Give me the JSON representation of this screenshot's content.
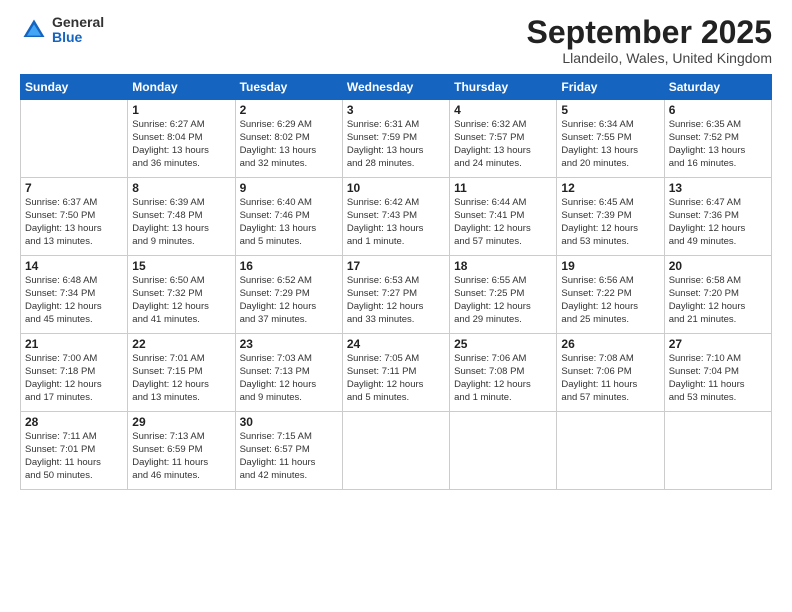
{
  "logo": {
    "general": "General",
    "blue": "Blue"
  },
  "title": "September 2025",
  "location": "Llandeilo, Wales, United Kingdom",
  "days_header": [
    "Sunday",
    "Monday",
    "Tuesday",
    "Wednesday",
    "Thursday",
    "Friday",
    "Saturday"
  ],
  "weeks": [
    [
      {
        "day": "",
        "info": ""
      },
      {
        "day": "1",
        "info": "Sunrise: 6:27 AM\nSunset: 8:04 PM\nDaylight: 13 hours\nand 36 minutes."
      },
      {
        "day": "2",
        "info": "Sunrise: 6:29 AM\nSunset: 8:02 PM\nDaylight: 13 hours\nand 32 minutes."
      },
      {
        "day": "3",
        "info": "Sunrise: 6:31 AM\nSunset: 7:59 PM\nDaylight: 13 hours\nand 28 minutes."
      },
      {
        "day": "4",
        "info": "Sunrise: 6:32 AM\nSunset: 7:57 PM\nDaylight: 13 hours\nand 24 minutes."
      },
      {
        "day": "5",
        "info": "Sunrise: 6:34 AM\nSunset: 7:55 PM\nDaylight: 13 hours\nand 20 minutes."
      },
      {
        "day": "6",
        "info": "Sunrise: 6:35 AM\nSunset: 7:52 PM\nDaylight: 13 hours\nand 16 minutes."
      }
    ],
    [
      {
        "day": "7",
        "info": "Sunrise: 6:37 AM\nSunset: 7:50 PM\nDaylight: 13 hours\nand 13 minutes."
      },
      {
        "day": "8",
        "info": "Sunrise: 6:39 AM\nSunset: 7:48 PM\nDaylight: 13 hours\nand 9 minutes."
      },
      {
        "day": "9",
        "info": "Sunrise: 6:40 AM\nSunset: 7:46 PM\nDaylight: 13 hours\nand 5 minutes."
      },
      {
        "day": "10",
        "info": "Sunrise: 6:42 AM\nSunset: 7:43 PM\nDaylight: 13 hours\nand 1 minute."
      },
      {
        "day": "11",
        "info": "Sunrise: 6:44 AM\nSunset: 7:41 PM\nDaylight: 12 hours\nand 57 minutes."
      },
      {
        "day": "12",
        "info": "Sunrise: 6:45 AM\nSunset: 7:39 PM\nDaylight: 12 hours\nand 53 minutes."
      },
      {
        "day": "13",
        "info": "Sunrise: 6:47 AM\nSunset: 7:36 PM\nDaylight: 12 hours\nand 49 minutes."
      }
    ],
    [
      {
        "day": "14",
        "info": "Sunrise: 6:48 AM\nSunset: 7:34 PM\nDaylight: 12 hours\nand 45 minutes."
      },
      {
        "day": "15",
        "info": "Sunrise: 6:50 AM\nSunset: 7:32 PM\nDaylight: 12 hours\nand 41 minutes."
      },
      {
        "day": "16",
        "info": "Sunrise: 6:52 AM\nSunset: 7:29 PM\nDaylight: 12 hours\nand 37 minutes."
      },
      {
        "day": "17",
        "info": "Sunrise: 6:53 AM\nSunset: 7:27 PM\nDaylight: 12 hours\nand 33 minutes."
      },
      {
        "day": "18",
        "info": "Sunrise: 6:55 AM\nSunset: 7:25 PM\nDaylight: 12 hours\nand 29 minutes."
      },
      {
        "day": "19",
        "info": "Sunrise: 6:56 AM\nSunset: 7:22 PM\nDaylight: 12 hours\nand 25 minutes."
      },
      {
        "day": "20",
        "info": "Sunrise: 6:58 AM\nSunset: 7:20 PM\nDaylight: 12 hours\nand 21 minutes."
      }
    ],
    [
      {
        "day": "21",
        "info": "Sunrise: 7:00 AM\nSunset: 7:18 PM\nDaylight: 12 hours\nand 17 minutes."
      },
      {
        "day": "22",
        "info": "Sunrise: 7:01 AM\nSunset: 7:15 PM\nDaylight: 12 hours\nand 13 minutes."
      },
      {
        "day": "23",
        "info": "Sunrise: 7:03 AM\nSunset: 7:13 PM\nDaylight: 12 hours\nand 9 minutes."
      },
      {
        "day": "24",
        "info": "Sunrise: 7:05 AM\nSunset: 7:11 PM\nDaylight: 12 hours\nand 5 minutes."
      },
      {
        "day": "25",
        "info": "Sunrise: 7:06 AM\nSunset: 7:08 PM\nDaylight: 12 hours\nand 1 minute."
      },
      {
        "day": "26",
        "info": "Sunrise: 7:08 AM\nSunset: 7:06 PM\nDaylight: 11 hours\nand 57 minutes."
      },
      {
        "day": "27",
        "info": "Sunrise: 7:10 AM\nSunset: 7:04 PM\nDaylight: 11 hours\nand 53 minutes."
      }
    ],
    [
      {
        "day": "28",
        "info": "Sunrise: 7:11 AM\nSunset: 7:01 PM\nDaylight: 11 hours\nand 50 minutes."
      },
      {
        "day": "29",
        "info": "Sunrise: 7:13 AM\nSunset: 6:59 PM\nDaylight: 11 hours\nand 46 minutes."
      },
      {
        "day": "30",
        "info": "Sunrise: 7:15 AM\nSunset: 6:57 PM\nDaylight: 11 hours\nand 42 minutes."
      },
      {
        "day": "",
        "info": ""
      },
      {
        "day": "",
        "info": ""
      },
      {
        "day": "",
        "info": ""
      },
      {
        "day": "",
        "info": ""
      }
    ]
  ]
}
